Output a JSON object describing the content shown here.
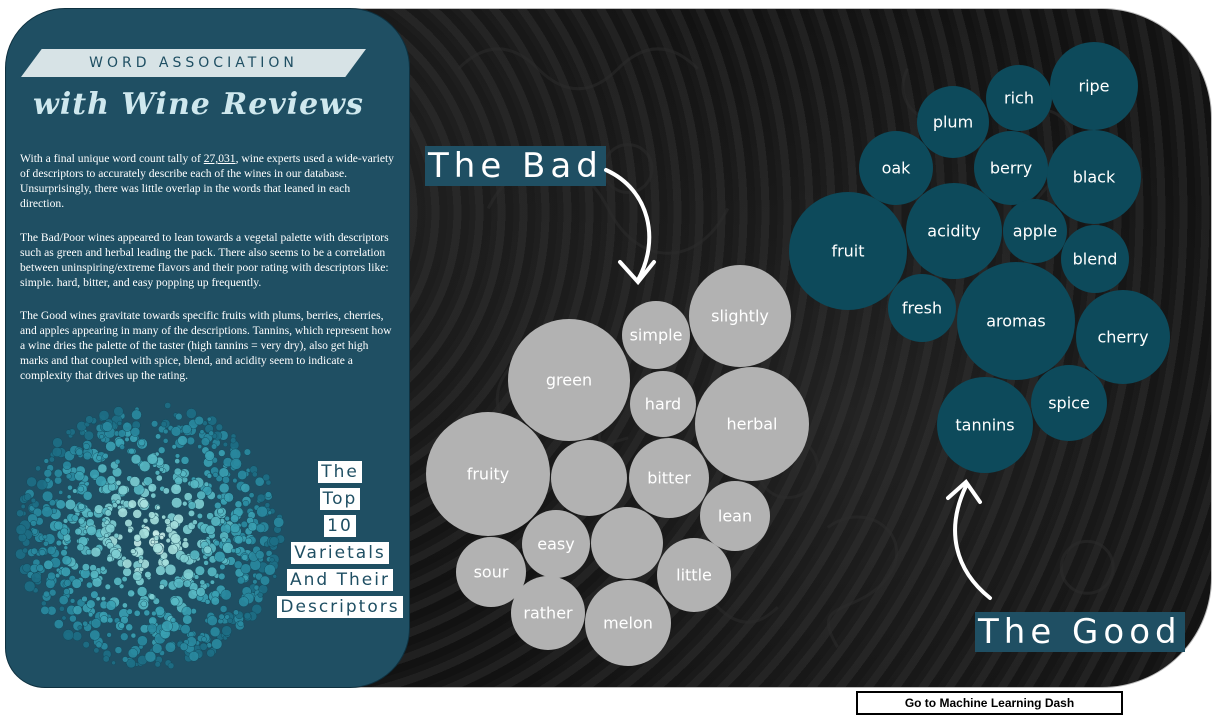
{
  "sidebar": {
    "banner_title": "WORD ASSOCIATION",
    "subtitle": "with Wine Reviews",
    "para1_a": "With a final unique word count tally of ",
    "para1_count": "27,031",
    "para1_b": ", wine experts used a wide-variety of descriptors to accurately describe each of the wines in our database. Unsurprisingly, there was little overlap in the words that leaned in each direction.",
    "para2": "The Bad/Poor wines appeared to lean towards a vegetal palette with descriptors such as green and herbal leading the pack. There also seems to be a correlation between uninspiring/extreme flavors and their poor rating with descriptors like: simple. hard, bitter, and easy popping up frequently.",
    "para3": "The Good wines gravitate towards specific fruits with plums, berries, cherries, and apples appearing in many of the descriptions. Tannins, which represent how a wine dries the palette of the taster (high tannins = very dry), also get high marks and that coupled with spice, blend, and acidity seem to indicate a complexity that drives up the rating.",
    "top10_lines": [
      "The",
      "Top",
      "10",
      "Varietals",
      "And Their",
      "Descriptors"
    ]
  },
  "bad": {
    "heading": "The Bad",
    "color": "#b2b2b2",
    "words": [
      "slightly",
      "simple",
      "green",
      "hard",
      "herbal",
      "fruity",
      "",
      "bitter",
      "lean",
      "easy",
      "",
      "sour",
      "little",
      "rather",
      "melon"
    ]
  },
  "good": {
    "heading": "The Good",
    "color": "#0d4a5b",
    "words": [
      "ripe",
      "rich",
      "plum",
      "oak",
      "berry",
      "black",
      "acidity",
      "apple",
      "fruit",
      "blend",
      "fresh",
      "aromas",
      "cherry",
      "spice",
      "tannins"
    ]
  },
  "button": {
    "label": "Go to Machine Learning Dash"
  },
  "colors": {
    "sidebar": "#1f4f63",
    "background": "#111111"
  }
}
